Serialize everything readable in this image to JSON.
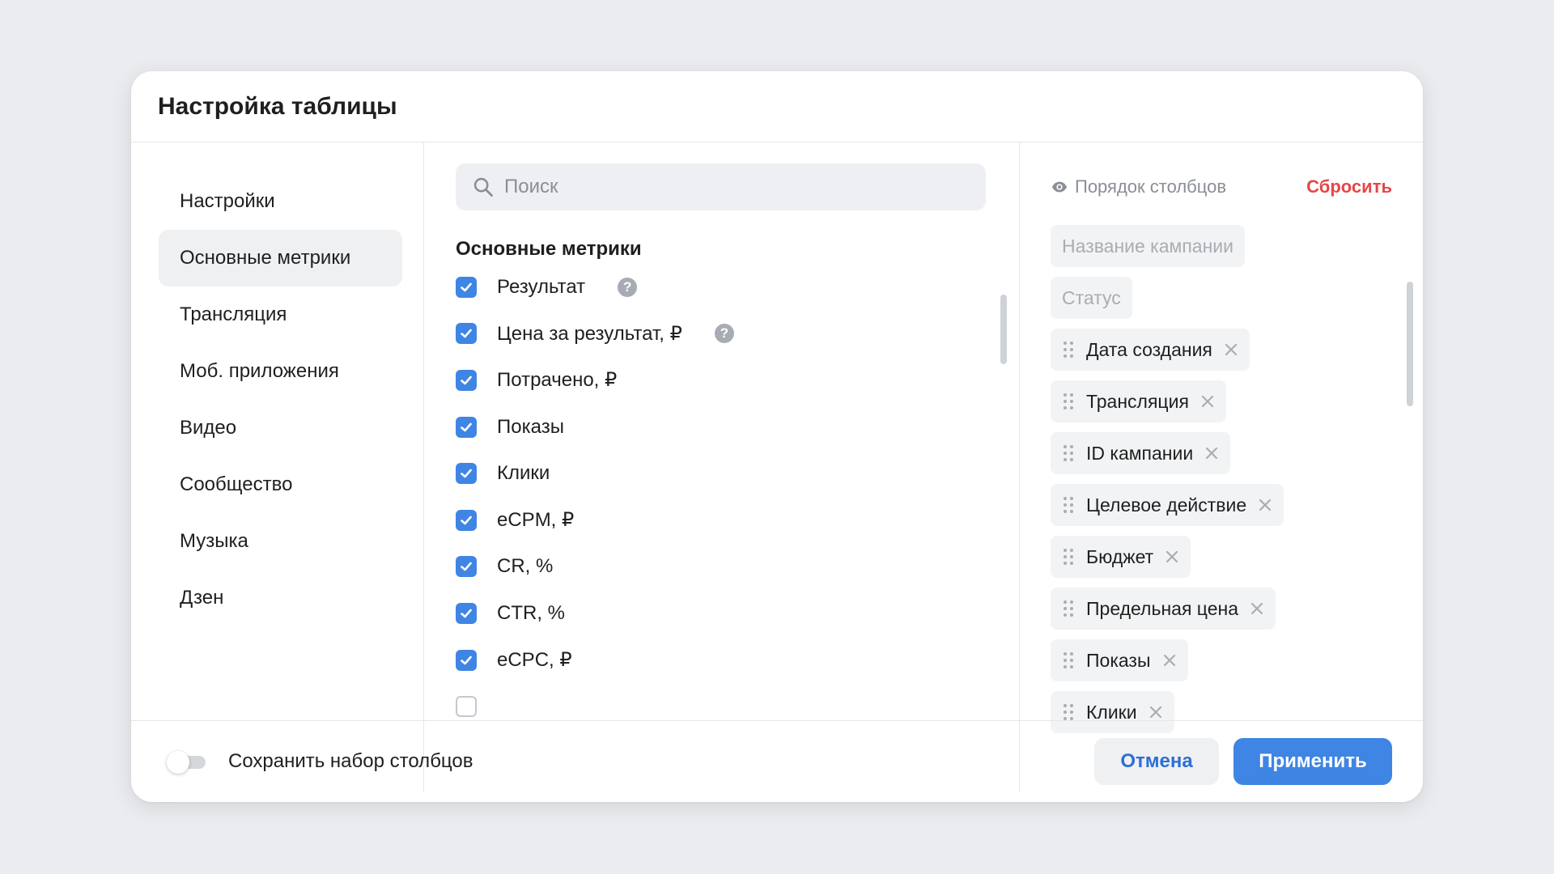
{
  "dialog": {
    "title": "Настройка таблицы"
  },
  "sidebar": {
    "items": [
      {
        "label": "Настройки"
      },
      {
        "label": "Основные метрики"
      },
      {
        "label": "Трансляция"
      },
      {
        "label": "Моб. приложения"
      },
      {
        "label": "Видео"
      },
      {
        "label": "Сообщество"
      },
      {
        "label": "Музыка"
      },
      {
        "label": "Дзен"
      }
    ],
    "active_index": 1
  },
  "search": {
    "placeholder": "Поиск",
    "value": ""
  },
  "metrics": {
    "section_title": "Основные метрики",
    "items": [
      {
        "label": "Результат",
        "checked": true,
        "help": "?"
      },
      {
        "label": "Цена за результат, ₽",
        "checked": true,
        "help": "?"
      },
      {
        "label": "Потрачено, ₽",
        "checked": true
      },
      {
        "label": "Показы",
        "checked": true
      },
      {
        "label": "Клики",
        "checked": true
      },
      {
        "label": "eCPM, ₽",
        "checked": true
      },
      {
        "label": "CR, %",
        "checked": true
      },
      {
        "label": "CTR, %",
        "checked": true
      },
      {
        "label": "eCPC, ₽",
        "checked": true
      }
    ]
  },
  "column_order": {
    "label": "Порядок столбцов",
    "reset_label": "Сбросить",
    "fixed": [
      {
        "label": "Название кампании"
      },
      {
        "label": "Статус"
      }
    ],
    "movable": [
      {
        "label": "Дата создания"
      },
      {
        "label": "Трансляция"
      },
      {
        "label": "ID кампании"
      },
      {
        "label": "Целевое действие"
      },
      {
        "label": "Бюджет"
      },
      {
        "label": "Предельная цена"
      },
      {
        "label": "Показы"
      },
      {
        "label": "Клики"
      }
    ]
  },
  "footer": {
    "save_toggle_label": "Сохранить набор столбцов",
    "save_toggle_on": false,
    "cancel_label": "Отмена",
    "apply_label": "Применить"
  },
  "colors": {
    "accent": "#3f85e4",
    "danger": "#e64646",
    "background": "#ebecf0"
  }
}
